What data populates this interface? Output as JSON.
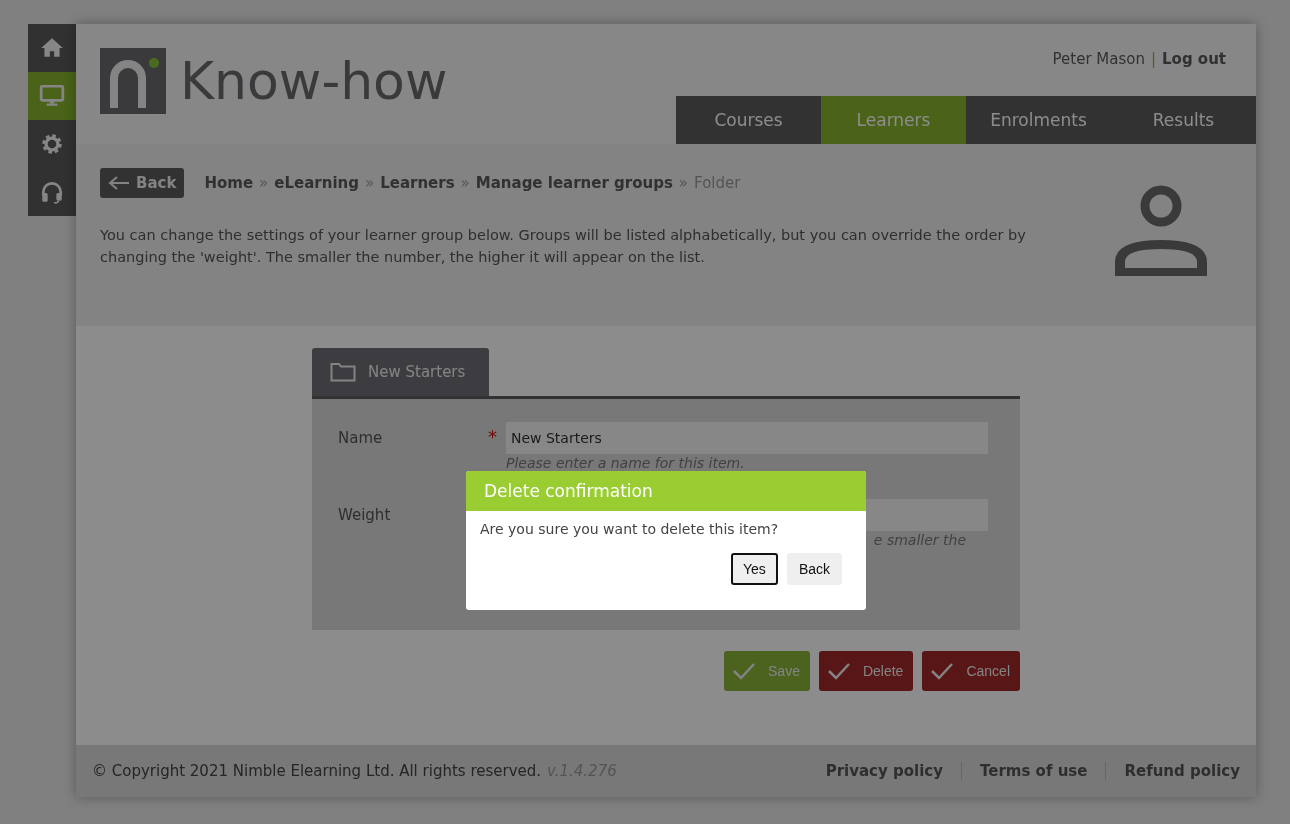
{
  "sidebar": {
    "items": [
      {
        "selected": false
      },
      {
        "selected": true
      },
      {
        "selected": false
      },
      {
        "selected": false
      }
    ]
  },
  "header": {
    "logo_text": "Know-how",
    "user": "Peter Mason",
    "separator": "|",
    "logout": "Log out"
  },
  "tabs": [
    {
      "label": "Courses",
      "selected": false
    },
    {
      "label": "Learners",
      "selected": true
    },
    {
      "label": "Enrolments",
      "selected": false
    },
    {
      "label": "Results",
      "selected": false
    }
  ],
  "back_button": "Back",
  "breadcrumb": [
    {
      "kind": "link",
      "text": "Home"
    },
    {
      "kind": "separator",
      "text": "»"
    },
    {
      "kind": "link",
      "text": "eLearning"
    },
    {
      "kind": "separator",
      "text": "»"
    },
    {
      "kind": "link",
      "text": "Learners"
    },
    {
      "kind": "separator",
      "text": "»"
    },
    {
      "kind": "link",
      "text": "Manage learner groups"
    },
    {
      "kind": "separator",
      "text": "»"
    },
    {
      "kind": "current",
      "text": "Folder"
    }
  ],
  "intro": "You can change the settings of your learner group below. Groups will be listed alphabetically, but you can override the order by changing the 'weight'. The smaller the number, the higher it will appear on the list.",
  "form": {
    "tab": "New Starters",
    "fields": [
      {
        "label": "Name",
        "required_mark": "*",
        "value": "New Starters",
        "help": "Please enter a name for this item."
      },
      {
        "label": "Weight",
        "help": "e smaller the"
      }
    ]
  },
  "actions": [
    {
      "kind": "save",
      "label": "Save"
    },
    {
      "kind": "danger",
      "label": "Delete"
    },
    {
      "kind": "danger",
      "label": "Cancel"
    }
  ],
  "footer": {
    "copyright": "© Copyright 2021 Nimble Elearning Ltd. All rights reserved.",
    "version": "v.1.4.276",
    "links": [
      "Privacy policy",
      "Terms of use",
      "Refund policy"
    ]
  },
  "dialog": {
    "title": "Delete confirmation",
    "message": "Are you sure you want to delete this item?",
    "buttons": [
      {
        "label": "Yes",
        "focused": true
      },
      {
        "label": "Back",
        "focused": false
      }
    ]
  }
}
